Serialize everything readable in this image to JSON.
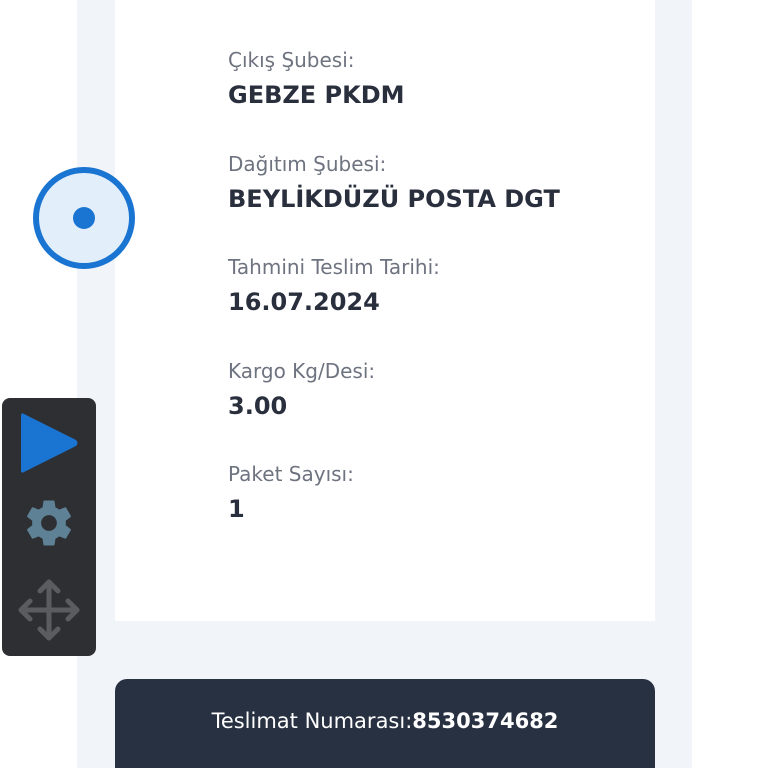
{
  "shipment": {
    "fields": [
      {
        "label": "Çıkış Şubesi:",
        "value": "GEBZE PKDM"
      },
      {
        "label": "Dağıtım Şubesi:",
        "value": "BEYLİKDÜZÜ POSTA DGT"
      },
      {
        "label": "Tahmini Teslim Tarihi:",
        "value": "16.07.2024"
      },
      {
        "label": "Kargo Kg/Desi:",
        "value": "3.00"
      },
      {
        "label": "Paket Sayısı:",
        "value": "1"
      }
    ]
  },
  "toolbar": {
    "icons": [
      "play-icon",
      "gear-icon",
      "move-icon"
    ]
  },
  "tracking": {
    "label": "Teslimat Numarası:",
    "number": "8530374682"
  },
  "colors": {
    "accent": "#1a74d2",
    "panel_bg": "#f1f4f8",
    "dark_bar": "#283142",
    "toolbar_bg": "#2d2f33"
  }
}
